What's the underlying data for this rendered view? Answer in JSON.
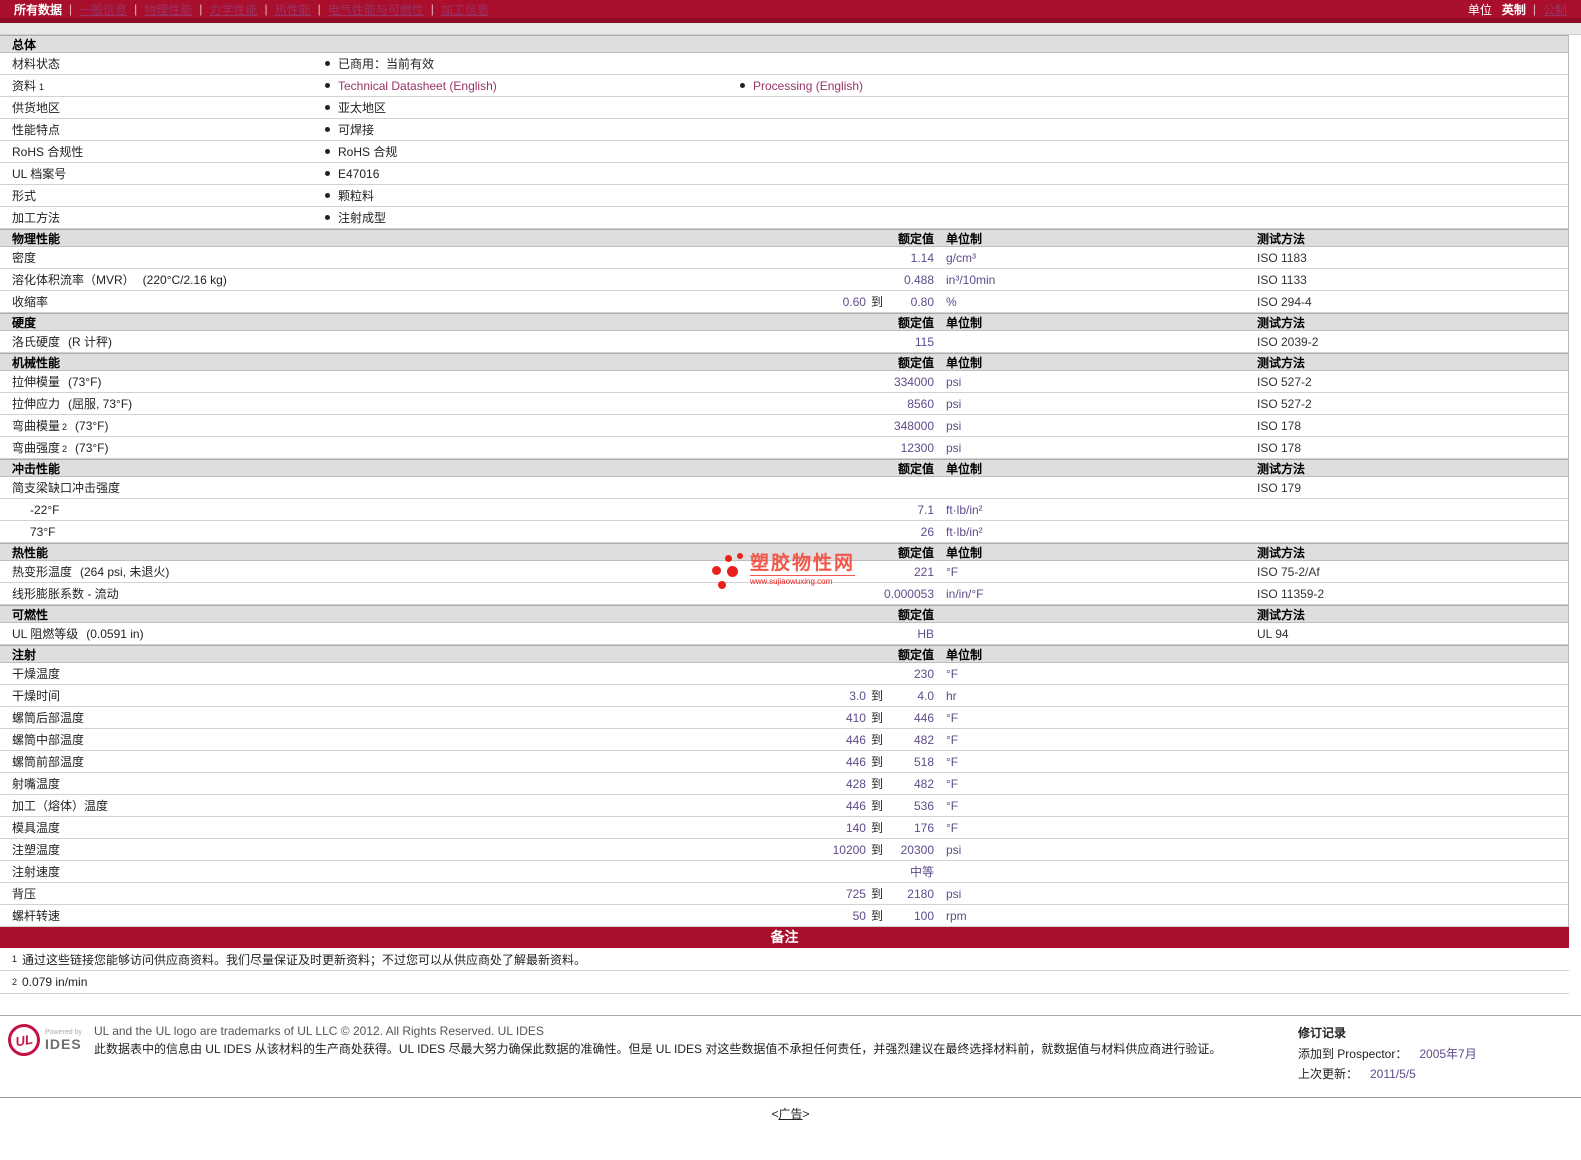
{
  "nav": {
    "tabs": [
      {
        "label": "所有数据",
        "active": true
      },
      {
        "label": "一般信息"
      },
      {
        "label": "物理性能"
      },
      {
        "label": "力学性能"
      },
      {
        "label": "热性能"
      },
      {
        "label": "电气性能与可燃性"
      },
      {
        "label": "加工信息"
      }
    ],
    "unit_label": "单位",
    "units": [
      {
        "label": "英制",
        "active": true
      },
      {
        "label": "公制"
      }
    ]
  },
  "watermark": {
    "title": "塑胶物性网",
    "url": "www.sujiaowuxing.com"
  },
  "table": {
    "range_sep": "到",
    "sections": [
      {
        "type": "general",
        "title": "总体",
        "rows": [
          {
            "label": "材料状态",
            "items": [
              {
                "text": "已商用：当前有效"
              }
            ]
          },
          {
            "label": "资料",
            "sup": "1",
            "items": [
              {
                "text": "Technical Datasheet (English)",
                "link": true
              },
              {
                "text": "Processing (English)",
                "link": true
              }
            ]
          },
          {
            "label": "供货地区",
            "items": [
              {
                "text": "亚太地区"
              }
            ]
          },
          {
            "label": "性能特点",
            "items": [
              {
                "text": "可焊接"
              }
            ]
          },
          {
            "label": "RoHS 合规性",
            "items": [
              {
                "text": "RoHS 合规"
              }
            ]
          },
          {
            "label": "UL 档案号",
            "items": [
              {
                "text": "E47016"
              }
            ]
          },
          {
            "label": "形式",
            "items": [
              {
                "text": "颗粒料"
              }
            ]
          },
          {
            "label": "加工方法",
            "items": [
              {
                "text": "注射成型"
              }
            ]
          }
        ]
      },
      {
        "type": "props",
        "title": "物理性能",
        "columns": {
          "rated": "额定值",
          "unit": "单位制",
          "method": "测试方法"
        },
        "rows": [
          {
            "label": "密度",
            "value": "1.14",
            "unit": "g/cm³",
            "method": "ISO 1183"
          },
          {
            "label": "溶化体积流率（MVR）",
            "cond": "(220°C/2.16 kg)",
            "value": "0.488",
            "unit": "in³/10min",
            "method": "ISO 1133"
          },
          {
            "label": "收缩率",
            "lo": "0.60",
            "hi": "0.80",
            "unit": "%",
            "method": "ISO 294-4"
          }
        ]
      },
      {
        "type": "props",
        "title": "硬度",
        "columns": {
          "rated": "额定值",
          "unit": "单位制",
          "method": "测试方法"
        },
        "rows": [
          {
            "label": "洛氏硬度",
            "cond": "(R 计秤)",
            "value": "115",
            "unit": "",
            "method": "ISO 2039-2"
          }
        ]
      },
      {
        "type": "props",
        "title": "机械性能",
        "columns": {
          "rated": "额定值",
          "unit": "单位制",
          "method": "测试方法"
        },
        "rows": [
          {
            "label": "拉伸模量",
            "cond": "(73°F)",
            "value": "334000",
            "unit": "psi",
            "method": "ISO 527-2"
          },
          {
            "label": "拉伸应力",
            "cond": "(屈服, 73°F)",
            "value": "8560",
            "unit": "psi",
            "method": "ISO 527-2"
          },
          {
            "label": "弯曲模量",
            "sup": "2",
            "cond": "(73°F)",
            "value": "348000",
            "unit": "psi",
            "method": "ISO 178"
          },
          {
            "label": "弯曲强度",
            "sup": "2",
            "cond": "(73°F)",
            "value": "12300",
            "unit": "psi",
            "method": "ISO 178"
          }
        ]
      },
      {
        "type": "props",
        "title": "冲击性能",
        "columns": {
          "rated": "额定值",
          "unit": "单位制",
          "method": "测试方法"
        },
        "rows": [
          {
            "label": "简支梁缺口冲击强度",
            "method": "ISO 179"
          },
          {
            "label": "-22°F",
            "indent": true,
            "value": "7.1",
            "unit": "ft·lb/in²"
          },
          {
            "label": "73°F",
            "indent": true,
            "value": "26",
            "unit": "ft·lb/in²"
          }
        ]
      },
      {
        "type": "props",
        "title": "热性能",
        "columns": {
          "rated": "额定值",
          "unit": "单位制",
          "method": "测试方法"
        },
        "rows": [
          {
            "label": "热变形温度",
            "cond": "(264 psi, 未退火)",
            "value": "221",
            "unit": "°F",
            "method": "ISO 75-2/Af"
          },
          {
            "label": "线形膨胀系数  - 流动",
            "value": "0.000053",
            "unit": "in/in/°F",
            "method": "ISO 11359-2"
          }
        ]
      },
      {
        "type": "props",
        "title": "可燃性",
        "columns": {
          "rated": "额定值",
          "unit": "",
          "method": "测试方法"
        },
        "rows": [
          {
            "label": "UL 阻燃等级",
            "cond": "(0.0591 in)",
            "value": "HB",
            "unit": "",
            "method": "UL 94"
          }
        ]
      },
      {
        "type": "props",
        "title": "注射",
        "columns": {
          "rated": "额定值",
          "unit": "单位制",
          "method": ""
        },
        "rows": [
          {
            "label": "干燥温度",
            "value": "230",
            "unit": "°F"
          },
          {
            "label": "干燥时间",
            "lo": "3.0",
            "hi": "4.0",
            "unit": "hr"
          },
          {
            "label": "螺筒后部温度",
            "lo": "410",
            "hi": "446",
            "unit": "°F"
          },
          {
            "label": "螺筒中部温度",
            "lo": "446",
            "hi": "482",
            "unit": "°F"
          },
          {
            "label": "螺筒前部温度",
            "lo": "446",
            "hi": "518",
            "unit": "°F"
          },
          {
            "label": "射嘴温度",
            "lo": "428",
            "hi": "482",
            "unit": "°F"
          },
          {
            "label": "加工（熔体）温度",
            "lo": "446",
            "hi": "536",
            "unit": "°F"
          },
          {
            "label": "模具温度",
            "lo": "140",
            "hi": "176",
            "unit": "°F"
          },
          {
            "label": "注塑温度",
            "lo": "10200",
            "hi": "20300",
            "unit": "psi"
          },
          {
            "label": "注射速度",
            "value": "中等",
            "unit": ""
          },
          {
            "label": "背压",
            "lo": "725",
            "hi": "2180",
            "unit": "psi"
          },
          {
            "label": "螺杆转速",
            "lo": "50",
            "hi": "100",
            "unit": "rpm"
          }
        ]
      }
    ]
  },
  "notes": {
    "banner": "备注",
    "items": [
      {
        "sup": "1",
        "text": "通过这些链接您能够访问供应商资料。我们尽量保证及时更新资料；不过您可以从供应商处了解最新资料。"
      },
      {
        "sup": "2",
        "text": "0.079 in/min"
      }
    ]
  },
  "footer": {
    "ul_monogram": "UL",
    "powered_by": "Powered by",
    "ides": "IDES",
    "trademark": "UL and the UL logo are trademarks of UL LLC © 2012. All Rights Reserved. UL IDES",
    "disclaimer": "此数据表中的信息由  UL IDES 从该材料的生产商处获得。UL IDES 尽最大努力确保此数据的准确性。但是  UL IDES 对这些数据值不承担任何责任，并强烈建议在最终选择材料前，就数据值与材料供应商进行验证。",
    "revision": {
      "title": "修订记录",
      "rows": [
        {
          "label": "添加到  Prospector：",
          "value": "2005年7月"
        },
        {
          "label": "上次更新：",
          "value": "2011/5/5"
        }
      ]
    }
  },
  "ad": {
    "open": "<",
    "label": "广告",
    "close": ">"
  },
  "colors": {
    "accent_red": "#A90E2C",
    "link_purple": "#993366",
    "value_purple": "#5F4B8B",
    "watermark_red": "#E8211D",
    "section_header_bg": "#DEDEDE"
  }
}
